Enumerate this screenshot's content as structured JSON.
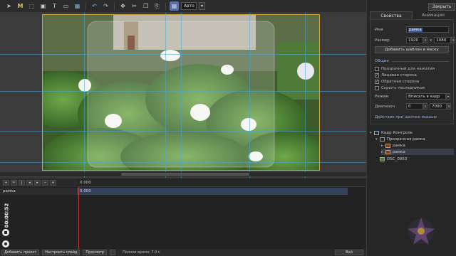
{
  "toolbar": {
    "zoom_value": "Авто",
    "icons": [
      "pointer-icon",
      "magic-icon",
      "select-rect-icon",
      "image-icon",
      "text-icon",
      "rect-icon",
      "picture-icon",
      "undo-icon",
      "redo-icon",
      "move-icon",
      "cut-icon",
      "copy-icon",
      "paste-icon",
      "grid-icon"
    ]
  },
  "right_panel": {
    "close_label": "Закрыть",
    "tabs": [
      "Свойства",
      "Анимация"
    ],
    "name_label": "Имя",
    "name_value": "рамка",
    "size_label": "Размер",
    "width_value": "1920",
    "size_sep": "x",
    "height_value": "1080",
    "add_template_button": "Добавить шаблон в маску",
    "general_section": "Общие",
    "checkboxes": [
      {
        "label": "Прозрачный для нажатия",
        "checked": false
      },
      {
        "label": "Лицевая сторона",
        "checked": true
      },
      {
        "label": "Обратная сторона",
        "checked": true
      },
      {
        "label": "Скрыть наследников",
        "checked": false
      }
    ],
    "mode_label": "Режим",
    "mode_value": "Вписать в кадр",
    "range_label": "Диапазон",
    "range_from": "0",
    "range_to": "7000",
    "mouse_action_section": "Действие при щелчке мышью"
  },
  "tree": {
    "items": [
      {
        "label": "Кадр Контроль",
        "level": 0
      },
      {
        "label": "Прозрачная рамка",
        "level": 1
      },
      {
        "label": "рамка",
        "level": 2
      },
      {
        "label": "рамка",
        "level": 2,
        "selected": true
      },
      {
        "label": "DSC_0953",
        "level": 1
      }
    ]
  },
  "timeline": {
    "ruler_time": "0.000",
    "track_name": "рамка",
    "clip_time": "0.000",
    "elapsed_time": "00:00:52"
  },
  "bottom_bar": {
    "buttons": [
      "Добавить проект",
      "Настроить слайд",
      "Просмотр",
      ""
    ],
    "duration_text": "Полное время: 7.0 с",
    "right_button": "Вой"
  },
  "colors": {
    "accent": "#3b5a9e",
    "frame": "#d2a44a",
    "guide": "#46aadc",
    "playhead": "#c43b3b"
  }
}
